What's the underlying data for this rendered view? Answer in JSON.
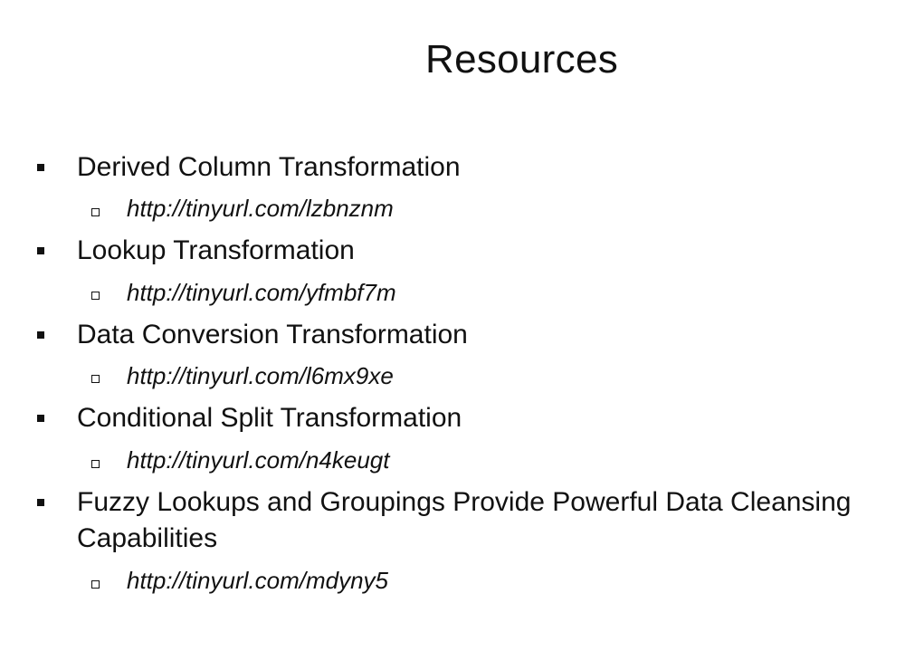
{
  "slide": {
    "title": "Resources"
  },
  "items": [
    {
      "label": "Derived Column Transformation",
      "link": "http://tinyurl.com/lzbnznm"
    },
    {
      "label": "Lookup Transformation",
      "link": "http://tinyurl.com/yfmbf7m"
    },
    {
      "label": "Data Conversion Transformation",
      "link": "http://tinyurl.com/l6mx9xe"
    },
    {
      "label": "Conditional Split Transformation",
      "link": "http://tinyurl.com/n4keugt"
    },
    {
      "label": "Fuzzy Lookups and Groupings Provide Powerful Data Cleansing Capabilities",
      "link": "http://tinyurl.com/mdyny5"
    }
  ],
  "icons": {
    "bullet": "filled-square-bullet-icon",
    "sub_bullet": "hollow-square-bullet-icon"
  }
}
